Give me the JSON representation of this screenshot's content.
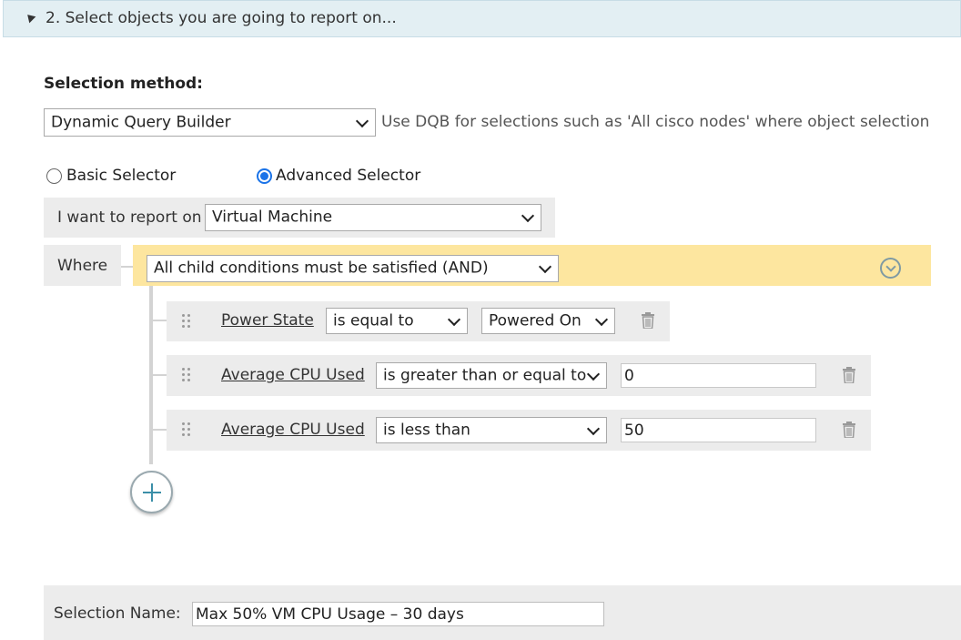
{
  "section": {
    "title": "2. Select objects you are going to report on..."
  },
  "selection_method": {
    "label": "Selection method:",
    "value": "Dynamic Query Builder",
    "hint": "Use DQB for selections such as 'All cisco nodes' where object selection"
  },
  "selector_mode": {
    "basic_label": "Basic Selector",
    "advanced_label": "Advanced Selector",
    "selected": "Advanced Selector"
  },
  "report_on": {
    "label": "I want to report on",
    "value": "Virtual Machine"
  },
  "where": {
    "label": "Where",
    "group_condition": "All child conditions must be satisfied (AND)"
  },
  "conditions": [
    {
      "field": "Power State",
      "operator": "is equal to",
      "value": "Powered On"
    },
    {
      "field": "Average CPU Used",
      "operator": "is greater than or equal to",
      "value": "0"
    },
    {
      "field": "Average CPU Used",
      "operator": "is less than",
      "value": "50"
    }
  ],
  "selection_name": {
    "label": "Selection Name:",
    "value": "Max 50% VM CPU Usage – 30 days"
  },
  "colors": {
    "header_bg": "#e3eff3",
    "group_bar": "#fde69f",
    "radio_accent": "#1a73e8",
    "panel_gray": "#ececec"
  }
}
